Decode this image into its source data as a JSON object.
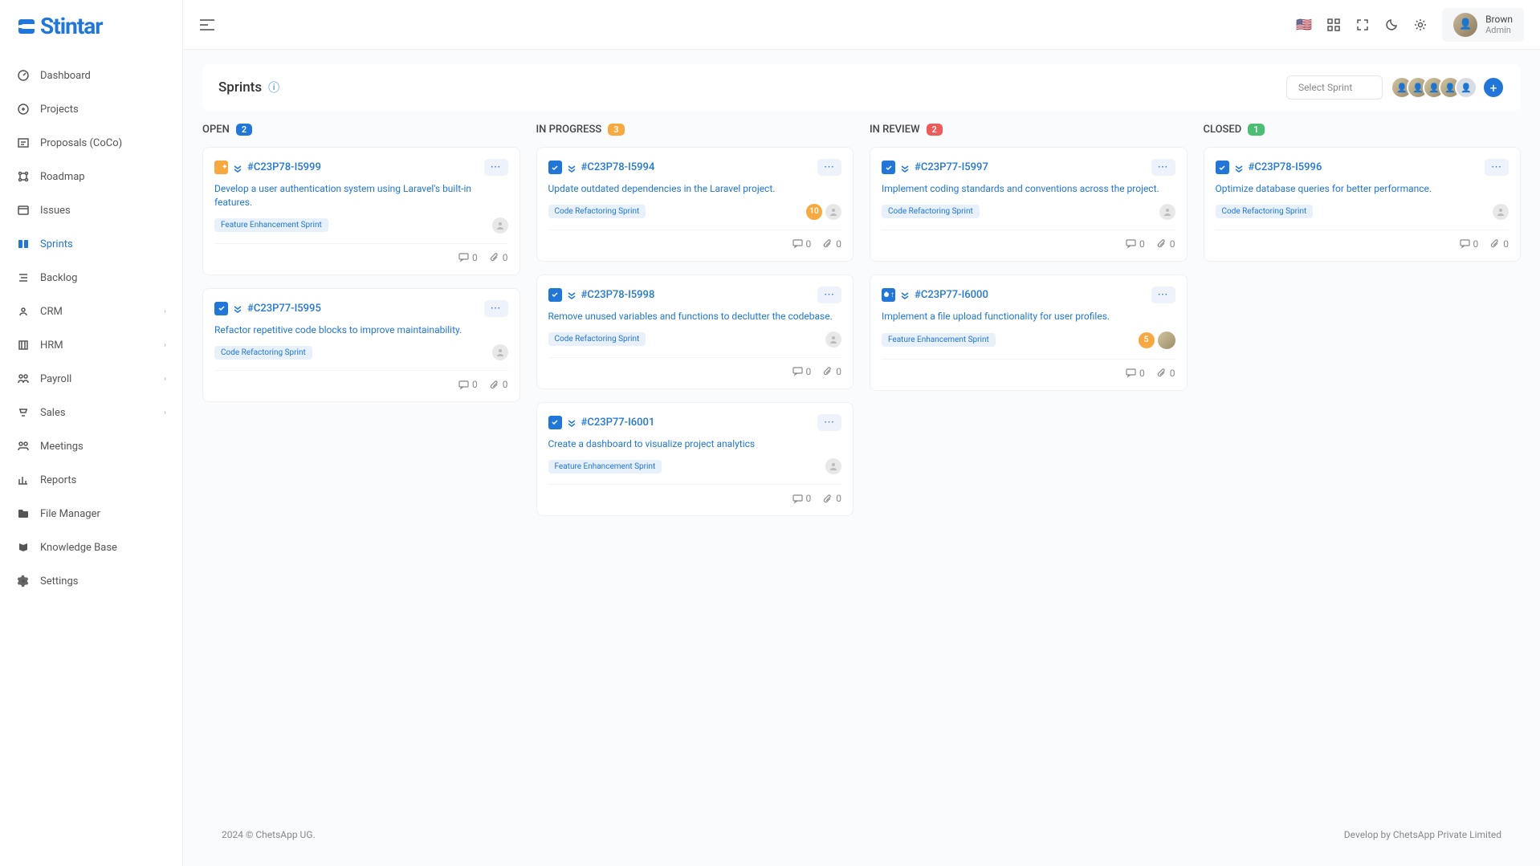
{
  "logo": "Stintar",
  "user": {
    "name": "Brown",
    "role": "Admin"
  },
  "sidebar": {
    "items": [
      {
        "label": "Dashboard"
      },
      {
        "label": "Projects"
      },
      {
        "label": "Proposals (CoCo)"
      },
      {
        "label": "Roadmap"
      },
      {
        "label": "Issues"
      },
      {
        "label": "Sprints",
        "active": true
      },
      {
        "label": "Backlog"
      },
      {
        "label": "CRM",
        "expandable": true
      },
      {
        "label": "HRM",
        "expandable": true
      },
      {
        "label": "Payroll",
        "expandable": true
      },
      {
        "label": "Sales",
        "expandable": true
      },
      {
        "label": "Meetings"
      },
      {
        "label": "Reports"
      },
      {
        "label": "File Manager"
      },
      {
        "label": "Knowledge Base"
      },
      {
        "label": "Settings"
      }
    ]
  },
  "page": {
    "title": "Sprints",
    "select_placeholder": "Select Sprint"
  },
  "columns": [
    {
      "title": "OPEN",
      "count": "2",
      "badge_class": "blue"
    },
    {
      "title": "IN PROGRESS",
      "count": "3",
      "badge_class": "orange"
    },
    {
      "title": "IN REVIEW",
      "count": "2",
      "badge_class": "red"
    },
    {
      "title": "CLOSED",
      "count": "1",
      "badge_class": "green"
    }
  ],
  "cards": {
    "open": [
      {
        "id": "#C23P78-I5999",
        "title": "Develop a user authentication system using Laravel's built-in features.",
        "tag": "Feature Enhancement Sprint",
        "comments": "0",
        "attachments": "0",
        "type": "feature"
      },
      {
        "id": "#C23P77-I5995",
        "title": "Refactor repetitive code blocks to improve maintainability.",
        "tag": "Code Refactoring Sprint",
        "comments": "0",
        "attachments": "0",
        "type": "task"
      }
    ],
    "progress": [
      {
        "id": "#C23P78-I5994",
        "title": "Update outdated dependencies in the Laravel project.",
        "tag": "Code Refactoring Sprint",
        "comments": "0",
        "attachments": "0",
        "count": "10",
        "type": "task"
      },
      {
        "id": "#C23P78-I5998",
        "title": "Remove unused variables and functions to declutter the codebase.",
        "tag": "Code Refactoring Sprint",
        "comments": "0",
        "attachments": "0",
        "type": "task"
      },
      {
        "id": "#C23P77-I6001",
        "title": "Create a dashboard to visualize project analytics",
        "tag": "Feature Enhancement Sprint",
        "comments": "0",
        "attachments": "0",
        "type": "task"
      }
    ],
    "review": [
      {
        "id": "#C23P77-I5997",
        "title": "Implement coding standards and conventions across the project.",
        "tag": "Code Refactoring Sprint",
        "comments": "0",
        "attachments": "0",
        "type": "task"
      },
      {
        "id": "#C23P77-I6000",
        "title": "Implement a file upload functionality for user profiles.",
        "tag": "Feature Enhancement Sprint",
        "comments": "0",
        "attachments": "0",
        "count": "5",
        "type": "bug",
        "assignee": true
      }
    ],
    "closed": [
      {
        "id": "#C23P78-I5996",
        "title": "Optimize database queries for better performance.",
        "tag": "Code Refactoring Sprint",
        "comments": "0",
        "attachments": "0",
        "type": "task"
      }
    ]
  },
  "footer": {
    "left": "2024 © ChetsApp UG.",
    "right": "Develop by ChetsApp Private Limited"
  }
}
